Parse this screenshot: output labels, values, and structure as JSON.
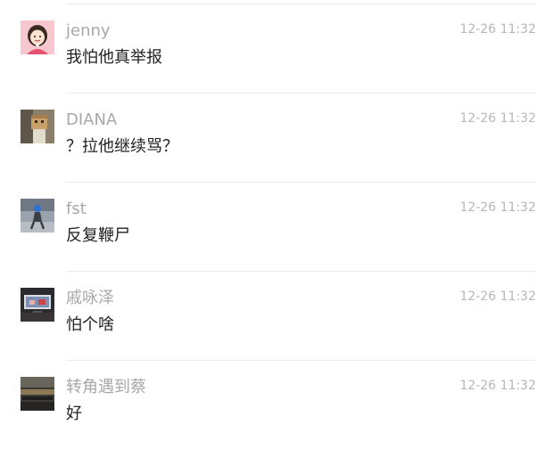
{
  "comments": [
    {
      "username": "jenny",
      "time": "12-26 11:32",
      "text": "我怕他真举报",
      "avatar": "girl-cartoon-avatar"
    },
    {
      "username": "DIANA",
      "time": "12-26 11:32",
      "text": "？拉他继续骂？",
      "avatar": "cardboard-box-avatar"
    },
    {
      "username": "fst",
      "time": "12-26 11:32",
      "text": "反复鞭尸",
      "avatar": "running-person-avatar"
    },
    {
      "username": "戚咏泽",
      "time": "12-26 11:32",
      "text": "怕个啥",
      "avatar": "dark-tv-room-avatar"
    },
    {
      "username": "转角遇到蔡",
      "time": "12-26 11:32",
      "text": "好",
      "avatar": "dark-scene-avatar"
    }
  ]
}
